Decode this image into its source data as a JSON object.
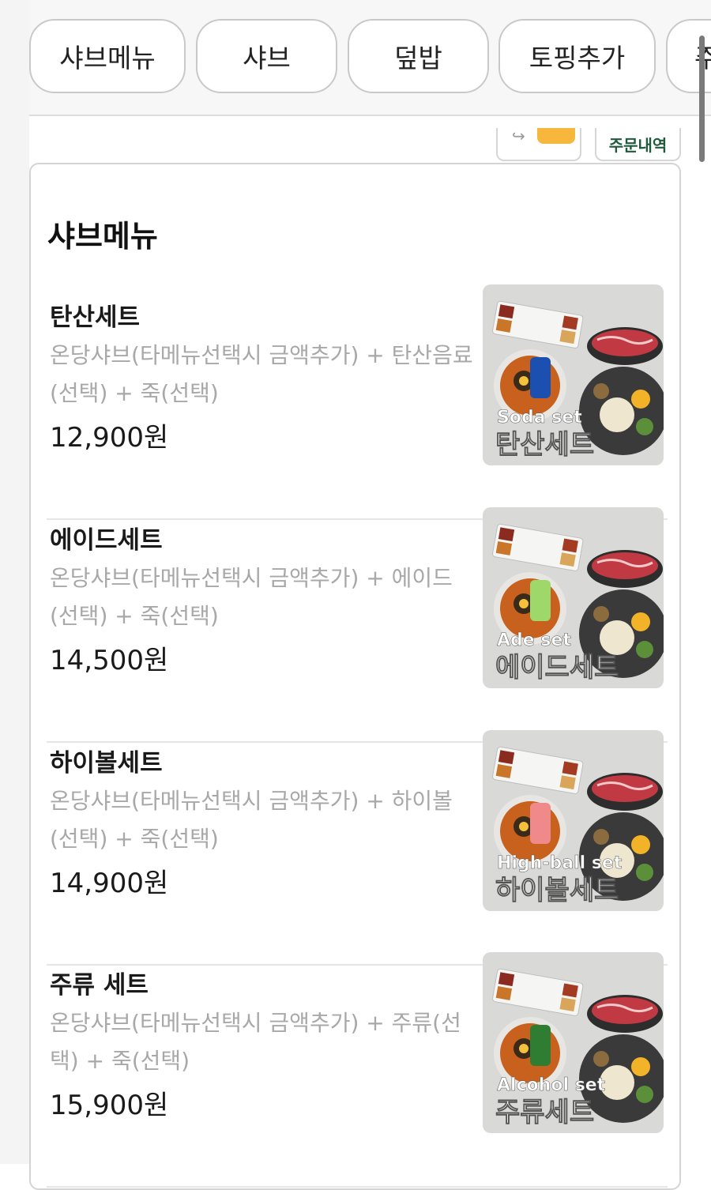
{
  "tabs": [
    "샤브메뉴",
    "샤브",
    "덮밥",
    "토핑추가",
    "주"
  ],
  "order_history_label": "주문내역",
  "section_title": "샤브메뉴",
  "items": [
    {
      "name": "탄산세트",
      "description": "온당샤브(타메뉴선택시 금액추가) + 탄산음료(선택) + 죽(선택)",
      "price": "12,900원",
      "image_en": "Soda set",
      "image_ko": "탄산세트",
      "drink_color": "#1b4fb0"
    },
    {
      "name": "에이드세트",
      "description": "온당샤브(타메뉴선택시 금액추가) + 에이드(선택) + 죽(선택)",
      "price": "14,500원",
      "image_en": "Ade set",
      "image_ko": "에이드세트",
      "drink_color": "#9ed76a"
    },
    {
      "name": "하이볼세트",
      "description": "온당샤브(타메뉴선택시 금액추가) + 하이볼(선택) + 죽(선택)",
      "price": "14,900원",
      "image_en": "High-ball set",
      "image_ko": "하이볼세트",
      "drink_color": "#f08a8a"
    },
    {
      "name": "주류 세트",
      "description": "온당샤브(타메뉴선택시 금액추가) + 주류(선택) + 죽(선택)",
      "price": "15,900원",
      "image_en": "Alcohol set",
      "image_ko": "주류세트",
      "drink_color": "#2e7d32"
    }
  ]
}
